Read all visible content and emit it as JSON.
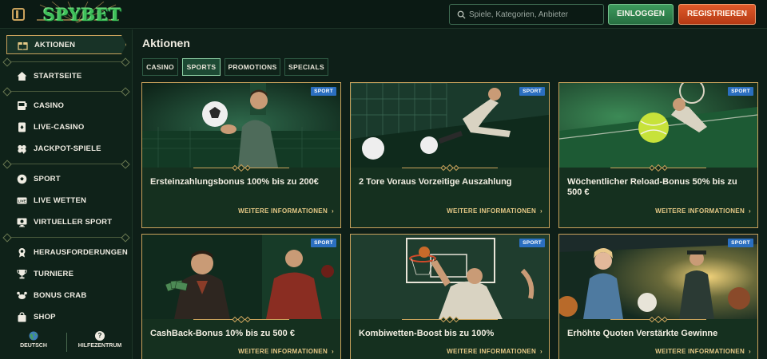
{
  "header": {
    "logo": "SPYBET",
    "search_placeholder": "Spiele, Kategorien, Anbieter",
    "login_label": "EINLOGGEN",
    "register_label": "REGISTRIEREN"
  },
  "sidebar": {
    "items": [
      {
        "label": "AKTIONEN",
        "icon": "gift-icon",
        "active": true
      },
      {
        "label": "STARTSEITE",
        "icon": "home-icon"
      },
      {
        "label": "CASINO",
        "icon": "slot-machine-icon"
      },
      {
        "label": "LIVE-CASINO",
        "icon": "card-icon"
      },
      {
        "label": "JACKPOT-SPIELE",
        "icon": "clover-icon"
      },
      {
        "label": "SPORT",
        "icon": "soccer-ball-icon"
      },
      {
        "label": "LIVE WETTEN",
        "icon": "live-icon"
      },
      {
        "label": "VIRTUELLER SPORT",
        "icon": "monitor-icon"
      },
      {
        "label": "HERAUSFORDERUNGEN",
        "icon": "medal-icon"
      },
      {
        "label": "TURNIERE",
        "icon": "trophy-icon"
      },
      {
        "label": "BONUS CRAB",
        "icon": "crab-icon"
      },
      {
        "label": "SHOP",
        "icon": "shopping-bag-icon"
      }
    ],
    "footer": {
      "language_label": "DEUTSCH",
      "help_label": "HILFEZENTRUM",
      "help_icon_glyph": "?"
    }
  },
  "main": {
    "title": "Aktionen",
    "tabs": [
      {
        "label": "CASINO",
        "active": false
      },
      {
        "label": "SPORTS",
        "active": true
      },
      {
        "label": "PROMOTIONS",
        "active": false
      },
      {
        "label": "SPECIALS",
        "active": false
      }
    ],
    "cards": [
      {
        "badge": "SPORT",
        "title": "Ersteinzahlungsbonus 100% bis zu 200€",
        "link": "WEITERE INFORMATIONEN"
      },
      {
        "badge": "SPORT",
        "title": "2 Tore Voraus Vorzeitige Auszahlung",
        "link": "WEITERE INFORMATIONEN"
      },
      {
        "badge": "SPORT",
        "title": "Wöchentlicher Reload-Bonus 50% bis zu 500 €",
        "link": "WEITERE INFORMATIONEN"
      },
      {
        "badge": "SPORT",
        "title": "CashBack-Bonus 10% bis zu 500 €",
        "link": "WEITERE INFORMATIONEN"
      },
      {
        "badge": "SPORT",
        "title": "Kombiwetten-Boost bis zu 100%",
        "link": "WEITERE INFORMATIONEN"
      },
      {
        "badge": "SPORT",
        "title": "Erhöhte Quoten Verstärkte Gewinne",
        "link": "WEITERE INFORMATIONEN"
      }
    ]
  },
  "colors": {
    "background": "#0e1f18",
    "accent_gold": "#c9a25c",
    "login_green": "#3c9a5d",
    "register_orange": "#e05a2a",
    "badge_blue": "#2b6fc0"
  }
}
